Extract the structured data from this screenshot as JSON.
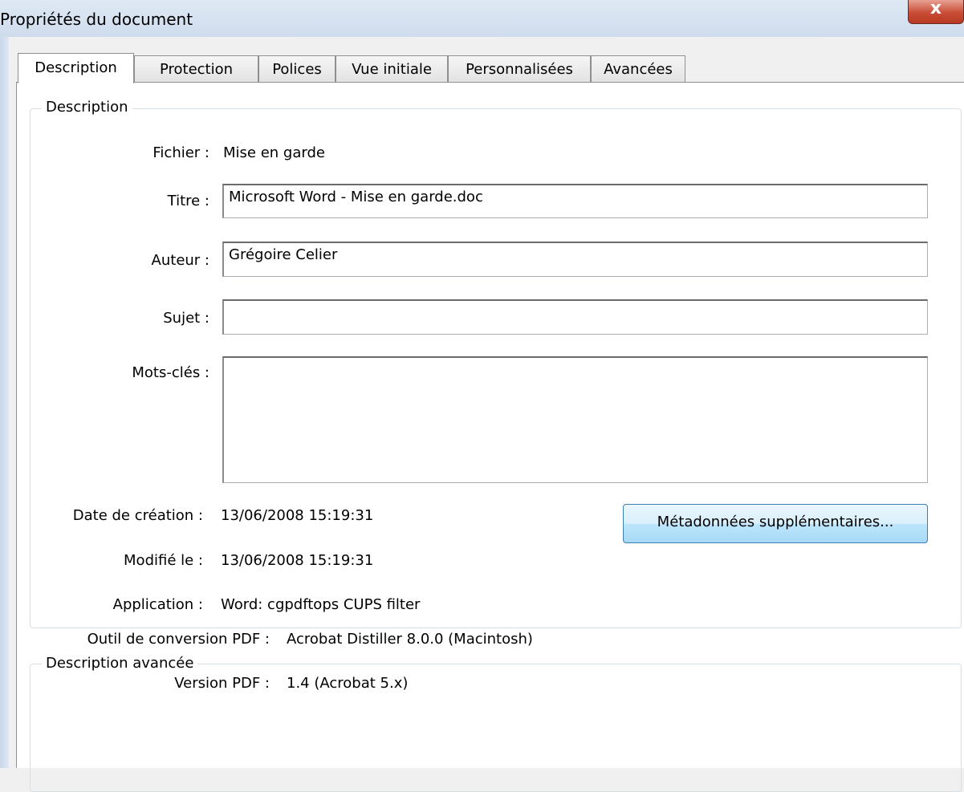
{
  "window": {
    "title": "Propriétés du document",
    "close_label": "x"
  },
  "tabs": [
    "Description",
    "Protection",
    "Polices",
    "Vue initiale",
    "Personnalisées",
    "Avancées"
  ],
  "description_group": {
    "label": "Description",
    "file_label": "Fichier :",
    "file_value": "Mise en garde",
    "title_label": "Titre :",
    "title_value": "Microsoft Word - Mise en garde.doc",
    "author_label": "Auteur :",
    "author_value": "Grégoire Celier",
    "subject_label": "Sujet :",
    "subject_value": "",
    "keywords_label": "Mots-clés :",
    "keywords_value": "",
    "created_label": "Date de création :",
    "created_value": "13/06/2008 15:19:31",
    "modified_label": "Modifié le :",
    "modified_value": "13/06/2008 15:19:31",
    "application_label": "Application :",
    "application_value": "Word: cgpdftops CUPS filter",
    "more_metadata_button": "Métadonnées supplémentaires..."
  },
  "advanced_group": {
    "label": "Description avancée",
    "converter_label": "Outil de conversion PDF :",
    "converter_value": "Acrobat Distiller 8.0.0 (Macintosh)",
    "version_label": "Version PDF :",
    "version_value": "1.4 (Acrobat 5.x)"
  }
}
